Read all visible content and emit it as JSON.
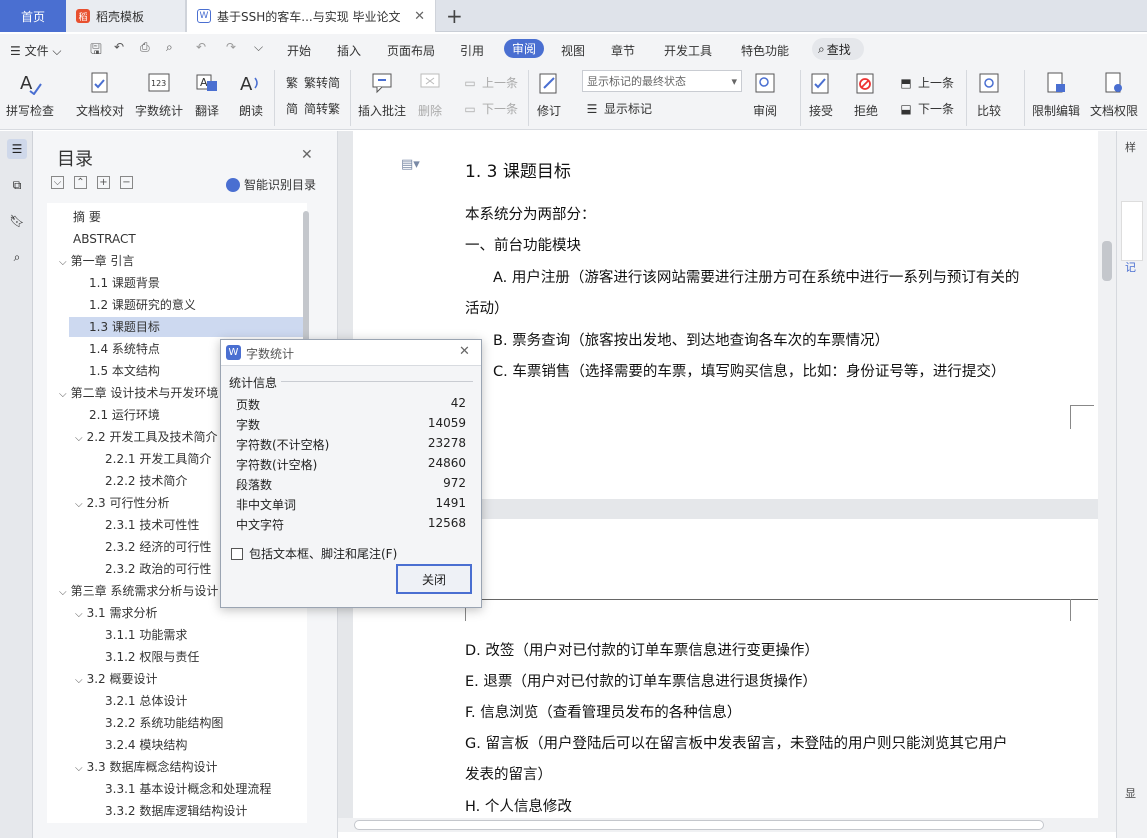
{
  "tabs": [
    {
      "label": "首页"
    },
    {
      "label": "稻壳模板",
      "icon": "docer-icon"
    },
    {
      "label": "基于SSH的客车...与实现 毕业论文",
      "icon": "wps-doc-icon"
    }
  ],
  "menu": [
    "文件",
    "开始",
    "插入",
    "页面布局",
    "引用",
    "审阅",
    "视图",
    "章节",
    "开发工具",
    "特色功能"
  ],
  "menu_active": "审阅",
  "search_label": "查找",
  "ribbon": {
    "spell_check": "拼写检查",
    "doc_proof": "文档校对",
    "word_count": "字数统计",
    "translate": "翻译",
    "read_aloud": "朗读",
    "trad_simp": "繁转简",
    "simp_trad": "简转繁",
    "insert_comment": "插入批注",
    "delete": "删除",
    "prev_comment": "上一条",
    "next_comment": "下一条",
    "revise": "修订",
    "markup_combo": "显示标记的最终状态",
    "show_markup": "显示标记",
    "review": "审阅",
    "accept": "接受",
    "reject": "拒绝",
    "prev_change": "上一条",
    "next_change": "下一条",
    "compare": "比较",
    "restrict_edit": "限制编辑",
    "doc_rights": "文档权限"
  },
  "toc": {
    "title": "目录",
    "smart_label": "智能识别目录",
    "items": [
      {
        "label": "摘    要",
        "level": 0,
        "arrow": false
      },
      {
        "label": "ABSTRACT",
        "level": 0,
        "arrow": false
      },
      {
        "label": "第一章 引言",
        "level": 0,
        "arrow": true
      },
      {
        "label": "1.1 课题背景",
        "level": 1,
        "arrow": false
      },
      {
        "label": "1.2 课题研究的意义",
        "level": 1,
        "arrow": false
      },
      {
        "label": "1.3 课题目标",
        "level": 1,
        "arrow": false,
        "selected": true
      },
      {
        "label": "1.4  系统特点",
        "level": 1,
        "arrow": false
      },
      {
        "label": "1.5 本文结构",
        "level": 1,
        "arrow": false
      },
      {
        "label": "第二章  设计技术与开发环境",
        "level": 0,
        "arrow": true
      },
      {
        "label": "2.1 运行环境",
        "level": 1,
        "arrow": false
      },
      {
        "label": "2.2 开发工具及技术简介",
        "level": 1,
        "arrow": true
      },
      {
        "label": "2.2.1 开发工具简介",
        "level": 2,
        "arrow": false
      },
      {
        "label": "2.2.2 技术简介",
        "level": 2,
        "arrow": false
      },
      {
        "label": "2.3  可行性分析",
        "level": 1,
        "arrow": true
      },
      {
        "label": "2.3.1  技术可性性",
        "level": 2,
        "arrow": false
      },
      {
        "label": "2.3.2 经济的可行性",
        "level": 2,
        "arrow": false
      },
      {
        "label": "2.3.2 政治的可行性",
        "level": 2,
        "arrow": false
      },
      {
        "label": "第三章  系统需求分析与设计",
        "level": 0,
        "arrow": true
      },
      {
        "label": "3.1 需求分析",
        "level": 1,
        "arrow": true
      },
      {
        "label": "3.1.1 功能需求",
        "level": 2,
        "arrow": false
      },
      {
        "label": "3.1.2 权限与责任",
        "level": 2,
        "arrow": false
      },
      {
        "label": "3.2 概要设计",
        "level": 1,
        "arrow": true
      },
      {
        "label": "3.2.1 总体设计",
        "level": 2,
        "arrow": false
      },
      {
        "label": "3.2.2 系统功能结构图",
        "level": 2,
        "arrow": false
      },
      {
        "label": "3.2.4 模块结构",
        "level": 2,
        "arrow": false
      },
      {
        "label": "3.3 数据库概念结构设计",
        "level": 1,
        "arrow": true
      },
      {
        "label": "3.3.1 基本设计概念和处理流程",
        "level": 2,
        "arrow": false
      },
      {
        "label": "3.3.2 数据库逻辑结构设计",
        "level": 2,
        "arrow": false
      }
    ]
  },
  "document": {
    "heading": "1. 3 课题目标",
    "page1_lines": [
      "本系统分为两部分：",
      "一、前台功能模块",
      "A. 用户注册（游客进行该网站需要进行注册方可在系统中进行一系列与预订有关的",
      "活动）",
      "B. 票务查询（旅客按出发地、到达地查询各车次的车票情况）",
      "C. 车票销售（选择需要的车票，填写购买信息，比如：身份证号等，进行提交）"
    ],
    "page2_lines": [
      "D. 改签（用户对已付款的订单车票信息进行变更操作）",
      "E. 退票（用户对已付款的订单车票信息进行退货操作）",
      "F. 信息浏览（查看管理员发布的各种信息）",
      "G. 留言板（用户登陆后可以在留言板中发表留言，未登陆的用户则只能浏览其它用户",
      "发表的留言）",
      "H. 个人信息修改"
    ]
  },
  "dialog": {
    "title": "字数统计",
    "section": "统计信息",
    "rows": [
      {
        "label": "页数",
        "value": "42"
      },
      {
        "label": "字数",
        "value": "14059"
      },
      {
        "label": "字符数(不计空格)",
        "value": "23278"
      },
      {
        "label": "字符数(计空格)",
        "value": "24860"
      },
      {
        "label": "段落数",
        "value": "972"
      },
      {
        "label": "非中文单词",
        "value": "1491"
      },
      {
        "label": "中文字符",
        "value": "12568"
      }
    ],
    "checkbox_label": "包括文本框、脚注和尾注(F)",
    "checkbox_checked": false,
    "close_label": "关闭"
  },
  "right_panel": {
    "text1": "样",
    "text2": "记",
    "text3": "显"
  },
  "colors": {
    "accent": "#4a6fd1",
    "selection": "#cdd9f0"
  }
}
